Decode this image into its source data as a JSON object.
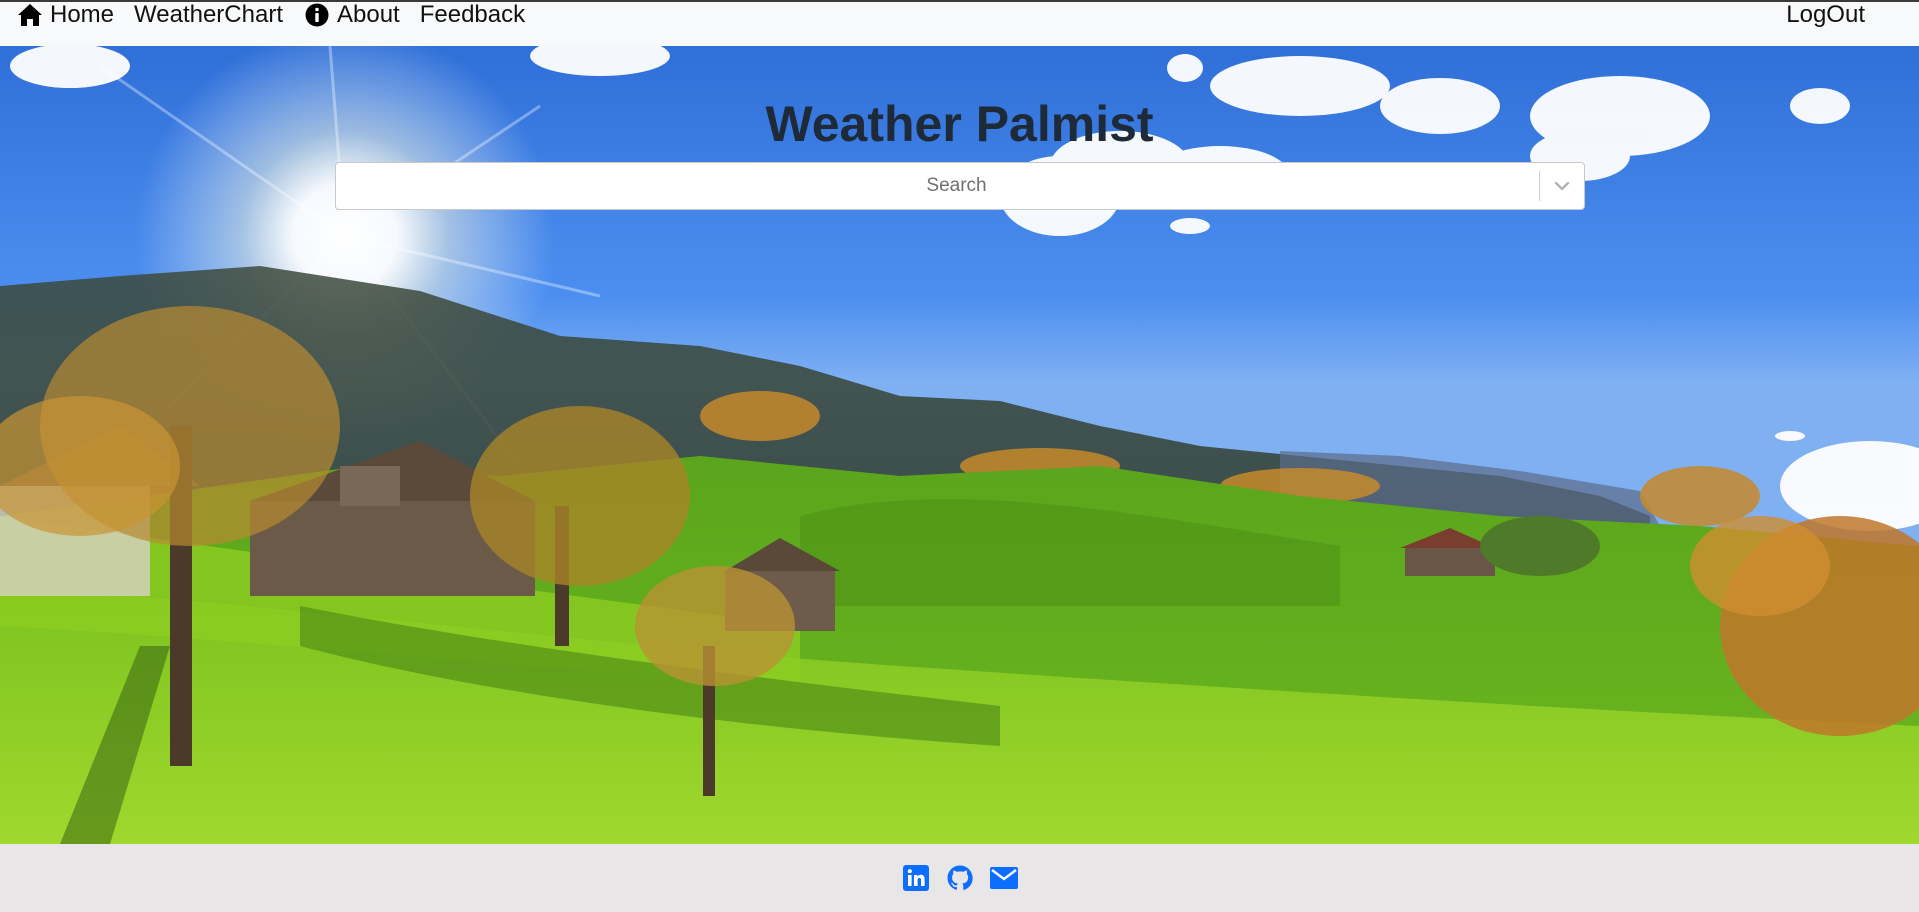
{
  "nav": {
    "home_label": "Home",
    "home_icon": "home-icon",
    "weatherchart_label": "WeatherChart",
    "about_label": "About",
    "about_icon": "info-icon",
    "feedback_label": "Feedback",
    "logout_label": "LogOut"
  },
  "hero": {
    "title": "Weather Palmist",
    "search": {
      "placeholder": "Search",
      "value": "",
      "toggle_icon": "chevron-down-icon"
    }
  },
  "footer": {
    "links": [
      {
        "icon": "linkedin-icon"
      },
      {
        "icon": "github-icon"
      },
      {
        "icon": "email-icon"
      }
    ],
    "icon_color": "#0d6efd"
  },
  "colors": {
    "navbar_bg": "#f8f9fa",
    "footer_bg": "#e8e6e6",
    "title_color": "#1e2a38"
  }
}
